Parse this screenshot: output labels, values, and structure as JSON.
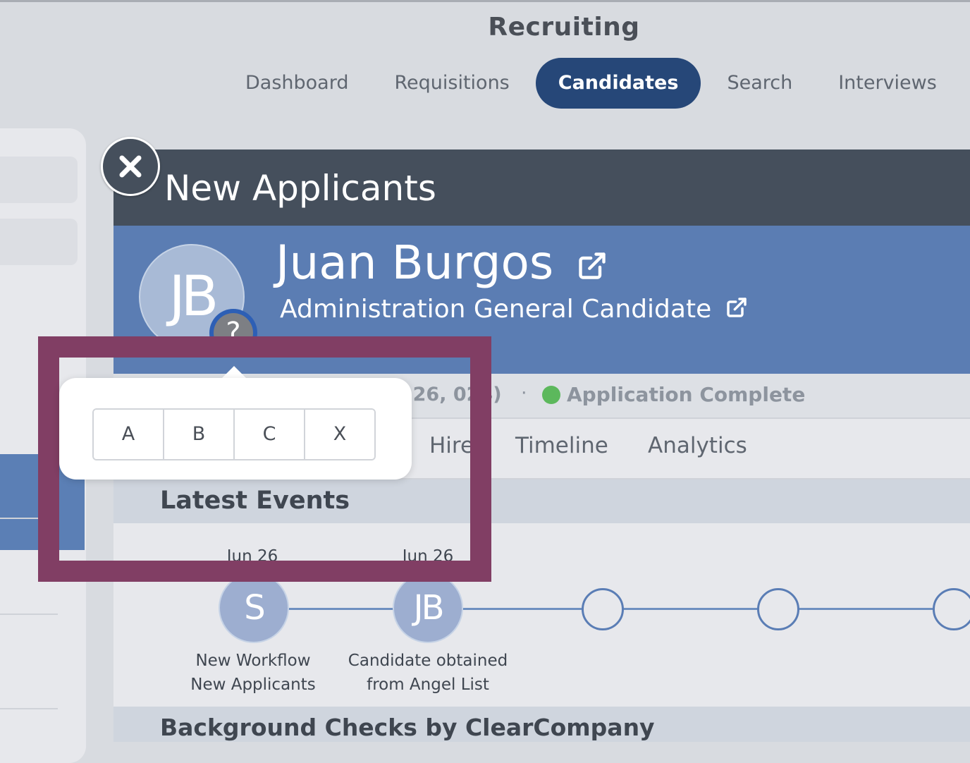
{
  "app": {
    "title": "Recruiting"
  },
  "nav": {
    "tabs": [
      {
        "label": "Dashboard",
        "active": false
      },
      {
        "label": "Requisitions",
        "active": false
      },
      {
        "label": "Candidates",
        "active": true
      },
      {
        "label": "Search",
        "active": false
      },
      {
        "label": "Interviews",
        "active": false
      }
    ]
  },
  "modal": {
    "title": "New Applicants",
    "candidate": {
      "initials": "JB",
      "name": "Juan Burgos",
      "requisition": "Administration General Candidate",
      "badge": "?"
    },
    "status": {
      "date_partial": "n 26, 024)",
      "separator": "·",
      "text": "Application Complete",
      "dot_color": "#5cb85c"
    },
    "tabs": [
      {
        "label": "Hire"
      },
      {
        "label": "Timeline"
      },
      {
        "label": "Analytics"
      }
    ],
    "latest_events": {
      "title": "Latest Events",
      "events": [
        {
          "date": "Jun 26",
          "initials": "S",
          "label_line1": "New Workflow",
          "label_line2": "New Applicants"
        },
        {
          "date": "Jun 26",
          "initials": "JB",
          "label_line1": "Candidate obtained",
          "label_line2": "from Angel List"
        }
      ]
    },
    "next_section": {
      "title": "Background Checks by ClearCompany"
    }
  },
  "popover": {
    "options": [
      "A",
      "B",
      "C",
      "X"
    ]
  },
  "colors": {
    "nav_active": "#264778",
    "header_bg": "#454f5c",
    "candidate_band": "#5b7db3",
    "highlight": "#813e64"
  }
}
